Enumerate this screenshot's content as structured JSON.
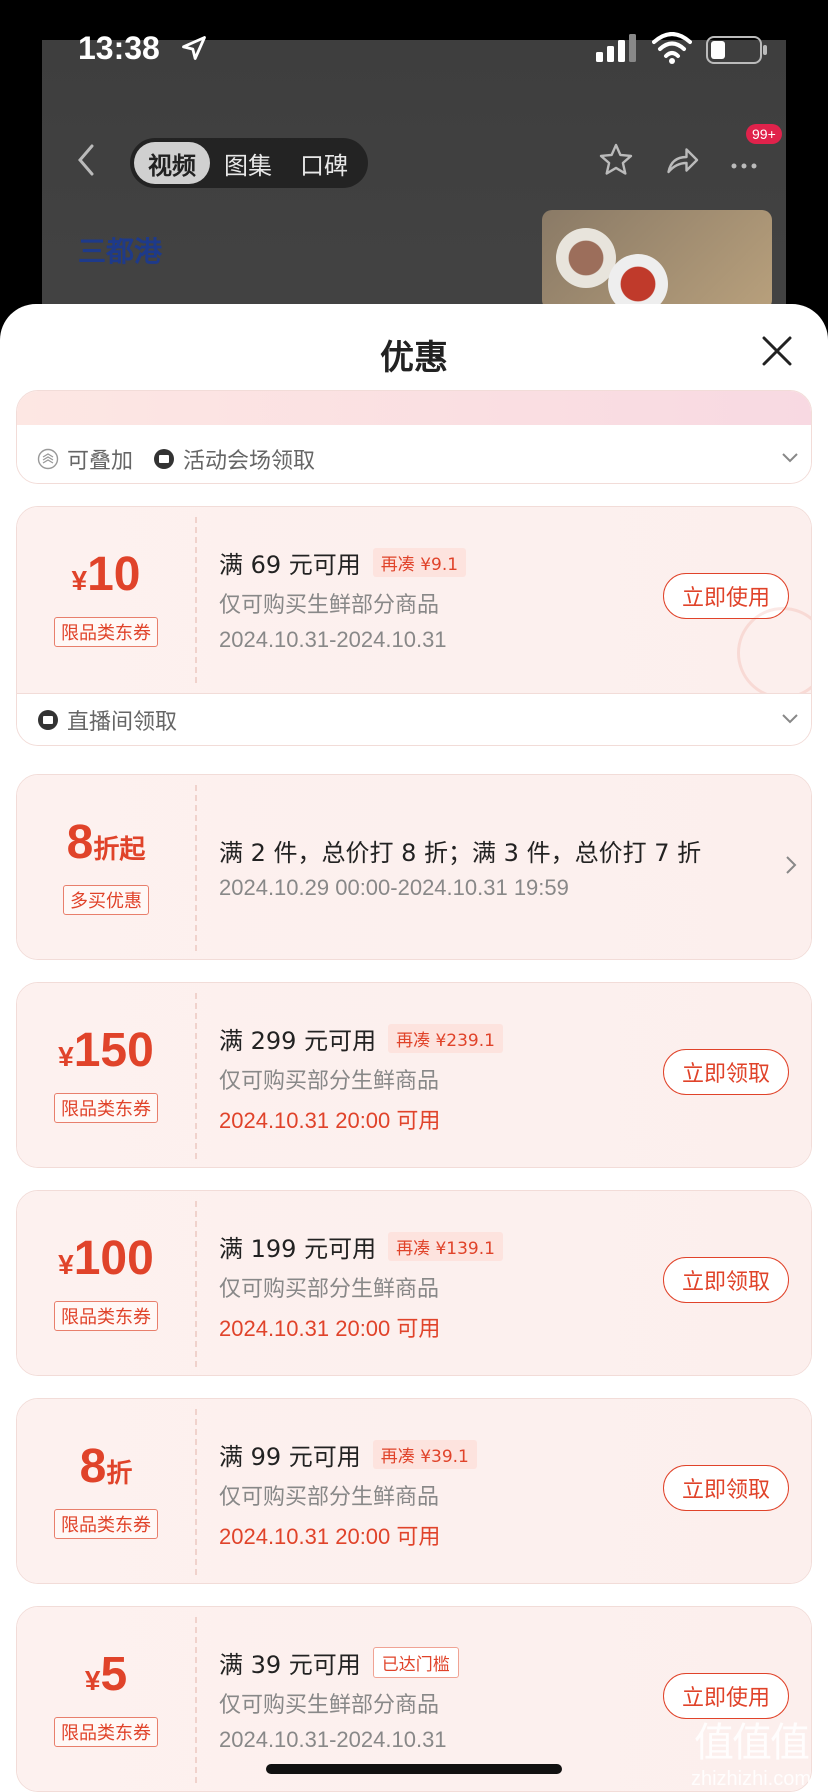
{
  "status": {
    "time": "13:38"
  },
  "page": {
    "tabs": [
      {
        "label": "视频"
      },
      {
        "label": "图集"
      },
      {
        "label": "口碑"
      }
    ],
    "notification_badge": "99+",
    "brand": "三都港"
  },
  "sheet": {
    "title": "优惠",
    "top_strip_footer": {
      "stackable": "可叠加",
      "source": "活动会场领取"
    },
    "coupons": [
      {
        "currency": "¥",
        "amount": "10",
        "suffix": "",
        "tag": "限品类东券",
        "condition": "满 69 元可用",
        "pill": "再凑 ¥9.1",
        "scope": "仅可购买生鲜部分商品",
        "date": "2024.10.31-2024.10.31",
        "button": "立即使用",
        "footer_source": "直播间领取"
      },
      {
        "currency": "",
        "amount": "8",
        "suffix": "折起",
        "tag": "多买优惠",
        "condition": "满 2 件，总价打 8 折；满 3 件，总价打 7 折",
        "date": "2024.10.29 00:00-2024.10.31 19:59"
      },
      {
        "currency": "¥",
        "amount": "150",
        "suffix": "",
        "tag": "限品类东券",
        "condition": "满 299 元可用",
        "pill": "再凑 ¥239.1",
        "scope": "仅可购买部分生鲜商品",
        "date": "2024.10.31 20:00 可用",
        "button": "立即领取"
      },
      {
        "currency": "¥",
        "amount": "100",
        "suffix": "",
        "tag": "限品类东券",
        "condition": "满 199 元可用",
        "pill": "再凑 ¥139.1",
        "scope": "仅可购买部分生鲜商品",
        "date": "2024.10.31 20:00 可用",
        "button": "立即领取"
      },
      {
        "currency": "",
        "amount": "8",
        "suffix": "折",
        "tag": "限品类东券",
        "condition": "满 99 元可用",
        "pill": "再凑 ¥39.1",
        "scope": "仅可购买部分生鲜商品",
        "date": "2024.10.31 20:00 可用",
        "button": "立即领取"
      },
      {
        "currency": "¥",
        "amount": "5",
        "suffix": "",
        "tag": "限品类东券",
        "condition": "满 39 元可用",
        "pill": "已达门槛",
        "scope": "仅可购买生鲜部分商品",
        "date": "2024.10.31-2024.10.31",
        "button": "立即使用"
      }
    ]
  },
  "watermark": {
    "text": "zhizhizhi.com",
    "mark": "值值值"
  },
  "colors": {
    "accent": "#e0432a",
    "card_bg": "#fdf1ef",
    "badge": "#e0224b"
  }
}
